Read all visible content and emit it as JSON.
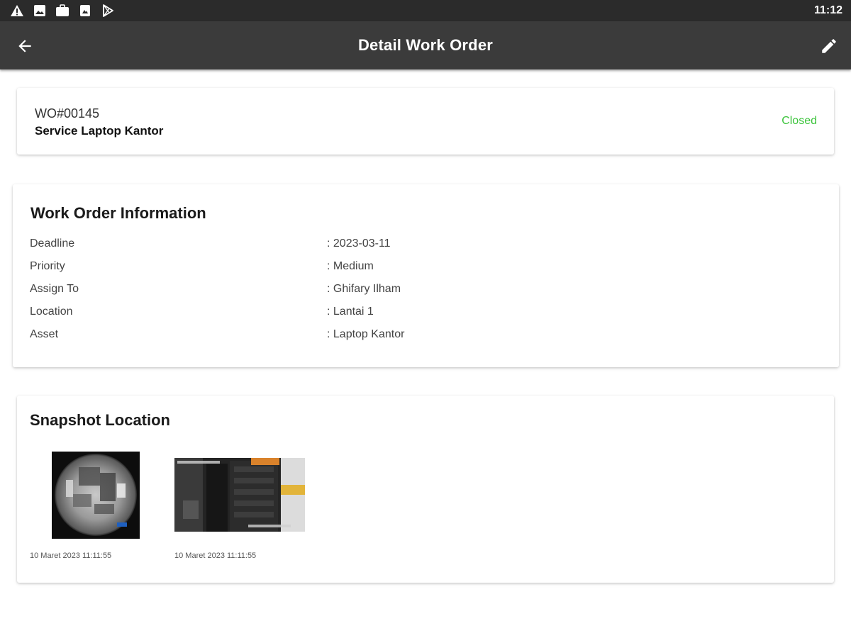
{
  "status_bar": {
    "icons": [
      "warning-icon",
      "image-icon",
      "briefcase-icon",
      "photo-icon",
      "play-store-icon"
    ],
    "time": "11:12"
  },
  "app_bar": {
    "title": "Detail Work Order",
    "back_icon": "arrow-left-icon",
    "edit_icon": "pencil-icon"
  },
  "work_order": {
    "number": "WO#00145",
    "name": "Service Laptop Kantor",
    "status": "Closed",
    "status_color": "#3cc43c"
  },
  "info": {
    "title": "Work Order Information",
    "rows": [
      {
        "label": "Deadline",
        "value": ": 2023-03-11"
      },
      {
        "label": "Priority",
        "value": ": Medium"
      },
      {
        "label": "Assign To",
        "value": ": Ghifary Ilham"
      },
      {
        "label": "Location",
        "value": ": Lantai 1"
      },
      {
        "label": "Asset",
        "value": ": Laptop Kantor"
      }
    ]
  },
  "snapshot": {
    "title": "Snapshot Location",
    "items": [
      {
        "caption": "10  Maret 2023 11:11:55"
      },
      {
        "caption": "10  Maret 2023 11:11:55"
      }
    ]
  },
  "colors": {
    "status_bar_bg": "#2b2b2b",
    "app_bar_bg": "#3b3b3b",
    "closed_green": "#3cc43c"
  }
}
